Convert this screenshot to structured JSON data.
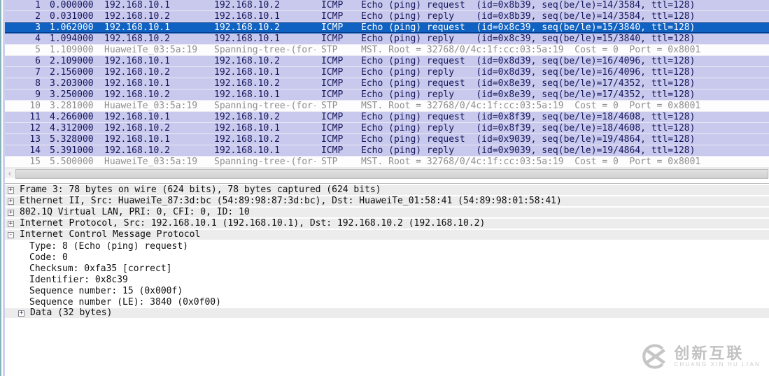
{
  "colors": {
    "icmp_row_bg": "#c9c9ed",
    "icmp_row_fg": "#16165c",
    "stp_row_fg": "#8f8f8f",
    "selected_row_bg": "#0f62c2",
    "selected_row_fg": "#ffffff",
    "detail_shaded_bg": "#ececec"
  },
  "packet_list": {
    "rows": [
      {
        "no": "1",
        "time": "0.000000",
        "source": "192.168.10.1",
        "destination": "192.168.10.2",
        "protocol": "ICMP",
        "info": "Echo (ping) request  (id=0x8b39, seq(be/le)=14/3584, ttl=128)",
        "type": "icmp",
        "selected": false
      },
      {
        "no": "2",
        "time": "0.031000",
        "source": "192.168.10.2",
        "destination": "192.168.10.1",
        "protocol": "ICMP",
        "info": "Echo (ping) reply    (id=0x8b39, seq(be/le)=14/3584, ttl=128)",
        "type": "icmp",
        "selected": false
      },
      {
        "no": "3",
        "time": "1.062000",
        "source": "192.168.10.1",
        "destination": "192.168.10.2",
        "protocol": "ICMP",
        "info": "Echo (ping) request  (id=0x8c39, seq(be/le)=15/3840, ttl=128)",
        "type": "icmp",
        "selected": true
      },
      {
        "no": "4",
        "time": "1.094000",
        "source": "192.168.10.2",
        "destination": "192.168.10.1",
        "protocol": "ICMP",
        "info": "Echo (ping) reply    (id=0x8c39, seq(be/le)=15/3840, ttl=128)",
        "type": "icmp",
        "selected": false
      },
      {
        "no": "5",
        "time": "1.109000",
        "source": "HuaweiTe_03:5a:19",
        "destination": "Spanning-tree-(for-",
        "protocol": "STP",
        "info": "MST. Root = 32768/0/4c:1f:cc:03:5a:19  Cost = 0  Port = 0x8001",
        "type": "stp",
        "selected": false
      },
      {
        "no": "6",
        "time": "2.109000",
        "source": "192.168.10.1",
        "destination": "192.168.10.2",
        "protocol": "ICMP",
        "info": "Echo (ping) request  (id=0x8d39, seq(be/le)=16/4096, ttl=128)",
        "type": "icmp",
        "selected": false
      },
      {
        "no": "7",
        "time": "2.156000",
        "source": "192.168.10.2",
        "destination": "192.168.10.1",
        "protocol": "ICMP",
        "info": "Echo (ping) reply    (id=0x8d39, seq(be/le)=16/4096, ttl=128)",
        "type": "icmp",
        "selected": false
      },
      {
        "no": "8",
        "time": "3.203000",
        "source": "192.168.10.1",
        "destination": "192.168.10.2",
        "protocol": "ICMP",
        "info": "Echo (ping) request  (id=0x8e39, seq(be/le)=17/4352, ttl=128)",
        "type": "icmp",
        "selected": false
      },
      {
        "no": "9",
        "time": "3.250000",
        "source": "192.168.10.2",
        "destination": "192.168.10.1",
        "protocol": "ICMP",
        "info": "Echo (ping) reply    (id=0x8e39, seq(be/le)=17/4352, ttl=128)",
        "type": "icmp",
        "selected": false
      },
      {
        "no": "10",
        "time": "3.281000",
        "source": "HuaweiTe_03:5a:19",
        "destination": "Spanning-tree-(for-",
        "protocol": "STP",
        "info": "MST. Root = 32768/0/4c:1f:cc:03:5a:19  Cost = 0  Port = 0x8001",
        "type": "stp",
        "selected": false
      },
      {
        "no": "11",
        "time": "4.266000",
        "source": "192.168.10.1",
        "destination": "192.168.10.2",
        "protocol": "ICMP",
        "info": "Echo (ping) request  (id=0x8f39, seq(be/le)=18/4608, ttl=128)",
        "type": "icmp",
        "selected": false
      },
      {
        "no": "12",
        "time": "4.312000",
        "source": "192.168.10.2",
        "destination": "192.168.10.1",
        "protocol": "ICMP",
        "info": "Echo (ping) reply    (id=0x8f39, seq(be/le)=18/4608, ttl=128)",
        "type": "icmp",
        "selected": false
      },
      {
        "no": "13",
        "time": "5.328000",
        "source": "192.168.10.1",
        "destination": "192.168.10.2",
        "protocol": "ICMP",
        "info": "Echo (ping) request  (id=0x9039, seq(be/le)=19/4864, ttl=128)",
        "type": "icmp",
        "selected": false
      },
      {
        "no": "14",
        "time": "5.391000",
        "source": "192.168.10.2",
        "destination": "192.168.10.1",
        "protocol": "ICMP",
        "info": "Echo (ping) reply    (id=0x9039, seq(be/le)=19/4864, ttl=128)",
        "type": "icmp",
        "selected": false
      },
      {
        "no": "15",
        "time": "5.500000",
        "source": "HuaweiTe_03:5a:19",
        "destination": "Spanning-tree-(for-",
        "protocol": "STP",
        "info": "MST. Root = 32768/0/4c:1f:cc:03:5a:19  Cost = 0  Port = 0x8001",
        "type": "stp",
        "selected": false
      }
    ]
  },
  "scrollbar": {
    "left_arrow": "‹"
  },
  "details": {
    "rows": [
      {
        "expander": "plus",
        "indent": 0,
        "shaded": true,
        "text": "Frame 3: 78 bytes on wire (624 bits), 78 bytes captured (624 bits)"
      },
      {
        "expander": "plus",
        "indent": 0,
        "shaded": true,
        "text": "Ethernet II, Src: HuaweiTe_87:3d:bc (54:89:98:87:3d:bc), Dst: HuaweiTe_01:58:41 (54:89:98:01:58:41)"
      },
      {
        "expander": "plus",
        "indent": 0,
        "shaded": true,
        "text": "802.1Q Virtual LAN, PRI: 0, CFI: 0, ID: 10"
      },
      {
        "expander": "plus",
        "indent": 0,
        "shaded": true,
        "text": "Internet Protocol, Src: 192.168.10.1 (192.168.10.1), Dst: 192.168.10.2 (192.168.10.2)"
      },
      {
        "expander": "minus",
        "indent": 0,
        "shaded": true,
        "text": "Internet Control Message Protocol"
      },
      {
        "expander": "none",
        "indent": 1,
        "shaded": false,
        "text": "Type: 8 (Echo (ping) request)"
      },
      {
        "expander": "none",
        "indent": 1,
        "shaded": false,
        "text": "Code: 0"
      },
      {
        "expander": "none",
        "indent": 1,
        "shaded": false,
        "text": "Checksum: 0xfa35 [correct]"
      },
      {
        "expander": "none",
        "indent": 1,
        "shaded": false,
        "text": "Identifier: 0x8c39"
      },
      {
        "expander": "none",
        "indent": 1,
        "shaded": false,
        "text": "Sequence number: 15 (0x000f)"
      },
      {
        "expander": "none",
        "indent": 1,
        "shaded": false,
        "text": "Sequence number (LE): 3840 (0x0f00)"
      },
      {
        "expander": "plus",
        "indent": 1,
        "shaded": true,
        "text": "Data (32 bytes)"
      }
    ],
    "expander_glyphs": {
      "plus": "+",
      "minus": "-"
    }
  },
  "watermark": {
    "title": "创新互联",
    "subtitle": "CHUANG XIN HU LIAN"
  }
}
